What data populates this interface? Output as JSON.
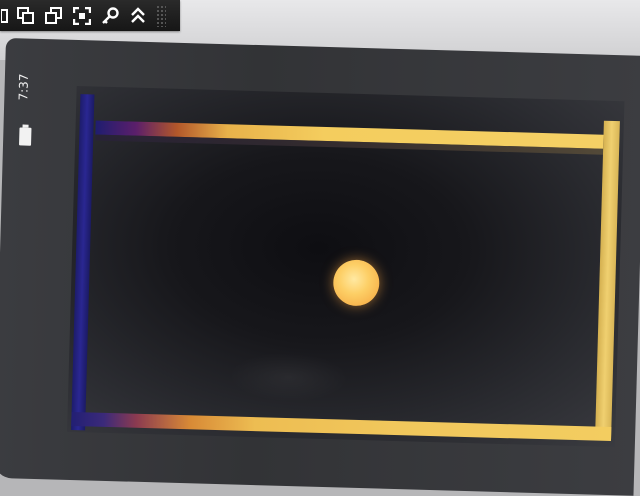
{
  "status_bar": {
    "time": "7:37",
    "battery_icon": "battery-icon"
  },
  "toolbar": {
    "icons": [
      "window-icon",
      "copy-window-icon",
      "paste-window-icon",
      "fullscreen-icon",
      "key-icon",
      "collapse-up-icon"
    ]
  },
  "game": {
    "ball_color": "#fdcf66",
    "left_wall_color": "#2a2792",
    "walls_color": "#f4cd5e"
  }
}
